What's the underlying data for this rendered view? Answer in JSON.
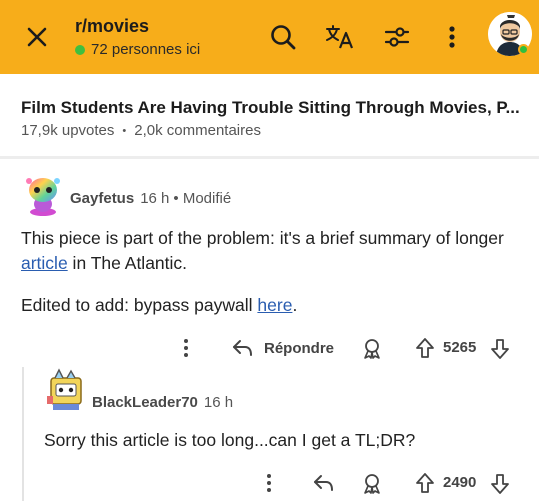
{
  "header": {
    "subreddit": "r/movies",
    "online_text": "72 personnes ici",
    "accent_color": "#f7ad1a",
    "icons": [
      "close-icon",
      "search-icon",
      "translate-icon",
      "filter-icon",
      "more-icon",
      "user-avatar"
    ]
  },
  "post": {
    "title": "Film Students Are Having Trouble Sitting Through Movies, P...",
    "upvotes": "17,9k upvotes",
    "separator": "•",
    "comments": "2,0k commentaires"
  },
  "comments": [
    {
      "author": "Gayfetus",
      "time": "16 h",
      "edited": "• Modifié",
      "body_part1": "This piece is part of the problem: it's a brief summary of longer ",
      "body_link": "article",
      "body_part2": " in The Atlantic.",
      "edit_prefix": "Edited to add: bypass paywall ",
      "edit_link": "here",
      "edit_suffix": ".",
      "reply_label": "Répondre",
      "score": "5265"
    },
    {
      "author": "BlackLeader70",
      "time": "16 h",
      "body": "Sorry this article is too long...can I get a TL;DR?",
      "score": "2490"
    }
  ]
}
